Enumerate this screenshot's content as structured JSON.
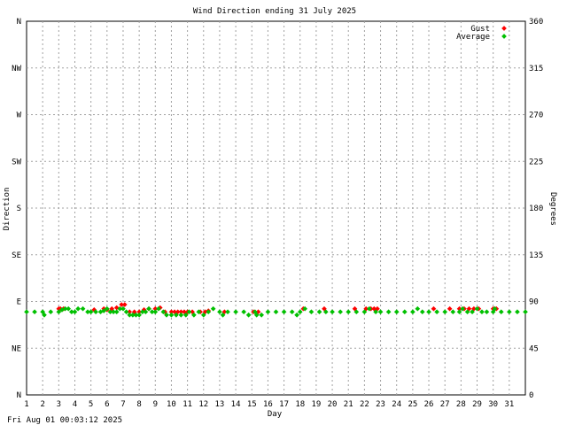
{
  "chart_data": {
    "type": "scatter",
    "title": "Wind Direction ending 31 July 2025",
    "xlabel": "Day",
    "ylabel_left": "Direction",
    "ylabel_right": "Degrees",
    "xlim": [
      1,
      32
    ],
    "ylim": [
      0,
      360
    ],
    "x_ticks": [
      "1",
      "2",
      "3",
      "4",
      "5",
      "6",
      "7",
      "8",
      "9",
      "10",
      "11",
      "12",
      "13",
      "14",
      "15",
      "16",
      "17",
      "18",
      "19",
      "20",
      "21",
      "22",
      "23",
      "24",
      "25",
      "26",
      "27",
      "28",
      "29",
      "30",
      "31"
    ],
    "left_ticks": [
      {
        "value": 360,
        "label": "N"
      },
      {
        "value": 315,
        "label": "NW"
      },
      {
        "value": 270,
        "label": "W"
      },
      {
        "value": 225,
        "label": "SW"
      },
      {
        "value": 180,
        "label": "S"
      },
      {
        "value": 135,
        "label": "SE"
      },
      {
        "value": 90,
        "label": "E"
      },
      {
        "value": 45,
        "label": "NE"
      },
      {
        "value": 0,
        "label": "N"
      }
    ],
    "right_ticks": [
      "360",
      "315",
      "270",
      "225",
      "180",
      "135",
      "90",
      "45",
      "0"
    ],
    "grid": true,
    "legend_position": "top-right",
    "series": [
      {
        "name": "Gust",
        "color": "#ff0000",
        "points": [
          [
            3.0,
            83
          ],
          [
            3.1,
            83
          ],
          [
            3.3,
            83
          ],
          [
            5.2,
            82
          ],
          [
            5.8,
            83
          ],
          [
            6.0,
            82
          ],
          [
            6.3,
            83
          ],
          [
            6.6,
            84
          ],
          [
            6.9,
            87
          ],
          [
            7.1,
            87
          ],
          [
            7.4,
            80
          ],
          [
            7.7,
            80
          ],
          [
            8.0,
            80
          ],
          [
            8.3,
            82
          ],
          [
            8.6,
            83
          ],
          [
            9.0,
            83
          ],
          [
            9.3,
            84
          ],
          [
            9.6,
            80
          ],
          [
            10.0,
            80
          ],
          [
            10.2,
            80
          ],
          [
            10.4,
            80
          ],
          [
            10.6,
            80
          ],
          [
            10.8,
            80
          ],
          [
            11.0,
            80
          ],
          [
            11.3,
            80
          ],
          [
            11.8,
            80
          ],
          [
            12.1,
            80
          ],
          [
            12.3,
            81
          ],
          [
            13.3,
            80
          ],
          [
            15.1,
            80
          ],
          [
            15.4,
            80
          ],
          [
            18.2,
            83
          ],
          [
            19.5,
            83
          ],
          [
            21.4,
            83
          ],
          [
            22.1,
            83
          ],
          [
            22.4,
            83
          ],
          [
            22.6,
            83
          ],
          [
            22.8,
            83
          ],
          [
            26.3,
            83
          ],
          [
            27.3,
            83
          ],
          [
            27.9,
            83
          ],
          [
            28.2,
            83
          ],
          [
            28.5,
            83
          ],
          [
            28.8,
            83
          ],
          [
            29.1,
            83
          ],
          [
            30.0,
            83
          ],
          [
            30.2,
            83
          ]
        ]
      },
      {
        "name": "Average",
        "color": "#00c000",
        "points": [
          [
            1.0,
            80
          ],
          [
            1.5,
            80
          ],
          [
            2.0,
            80
          ],
          [
            2.1,
            77
          ],
          [
            2.5,
            80
          ],
          [
            3.0,
            80
          ],
          [
            3.2,
            82
          ],
          [
            3.4,
            83
          ],
          [
            3.6,
            83
          ],
          [
            3.8,
            80
          ],
          [
            4.0,
            80
          ],
          [
            4.2,
            83
          ],
          [
            4.5,
            83
          ],
          [
            4.8,
            80
          ],
          [
            5.0,
            80
          ],
          [
            5.3,
            80
          ],
          [
            5.6,
            80
          ],
          [
            5.8,
            81
          ],
          [
            6.0,
            83
          ],
          [
            6.2,
            80
          ],
          [
            6.4,
            80
          ],
          [
            6.6,
            80
          ],
          [
            6.8,
            83
          ],
          [
            7.0,
            83
          ],
          [
            7.2,
            80
          ],
          [
            7.4,
            77
          ],
          [
            7.6,
            77
          ],
          [
            7.8,
            77
          ],
          [
            8.0,
            77
          ],
          [
            8.2,
            80
          ],
          [
            8.4,
            80
          ],
          [
            8.6,
            83
          ],
          [
            8.8,
            80
          ],
          [
            9.0,
            80
          ],
          [
            9.2,
            83
          ],
          [
            9.5,
            80
          ],
          [
            9.7,
            77
          ],
          [
            10.0,
            77
          ],
          [
            10.3,
            77
          ],
          [
            10.6,
            77
          ],
          [
            10.9,
            77
          ],
          [
            11.1,
            80
          ],
          [
            11.4,
            77
          ],
          [
            11.7,
            80
          ],
          [
            12.0,
            77
          ],
          [
            12.3,
            80
          ],
          [
            12.6,
            83
          ],
          [
            13.0,
            80
          ],
          [
            13.2,
            77
          ],
          [
            13.5,
            80
          ],
          [
            14.0,
            80
          ],
          [
            14.5,
            80
          ],
          [
            14.8,
            77
          ],
          [
            15.2,
            80
          ],
          [
            15.3,
            77
          ],
          [
            15.6,
            77
          ],
          [
            16.0,
            80
          ],
          [
            16.5,
            80
          ],
          [
            17.0,
            80
          ],
          [
            17.5,
            80
          ],
          [
            17.8,
            77
          ],
          [
            18.0,
            80
          ],
          [
            18.3,
            83
          ],
          [
            18.7,
            80
          ],
          [
            19.2,
            80
          ],
          [
            19.6,
            80
          ],
          [
            20.0,
            80
          ],
          [
            20.5,
            80
          ],
          [
            21.0,
            80
          ],
          [
            21.5,
            80
          ],
          [
            22.0,
            80
          ],
          [
            22.3,
            83
          ],
          [
            22.7,
            80
          ],
          [
            23.0,
            80
          ],
          [
            23.5,
            80
          ],
          [
            24.0,
            80
          ],
          [
            24.5,
            80
          ],
          [
            25.0,
            80
          ],
          [
            25.3,
            83
          ],
          [
            25.6,
            80
          ],
          [
            26.0,
            80
          ],
          [
            26.5,
            80
          ],
          [
            27.0,
            80
          ],
          [
            27.5,
            80
          ],
          [
            27.9,
            80
          ],
          [
            28.1,
            83
          ],
          [
            28.4,
            80
          ],
          [
            28.7,
            80
          ],
          [
            29.0,
            83
          ],
          [
            29.3,
            80
          ],
          [
            29.6,
            80
          ],
          [
            30.0,
            80
          ],
          [
            30.1,
            83
          ],
          [
            30.5,
            80
          ],
          [
            31.0,
            80
          ],
          [
            31.5,
            80
          ],
          [
            32.0,
            80
          ]
        ]
      }
    ]
  },
  "footer": {
    "timestamp": "Fri Aug 01 00:03:12 2025"
  }
}
